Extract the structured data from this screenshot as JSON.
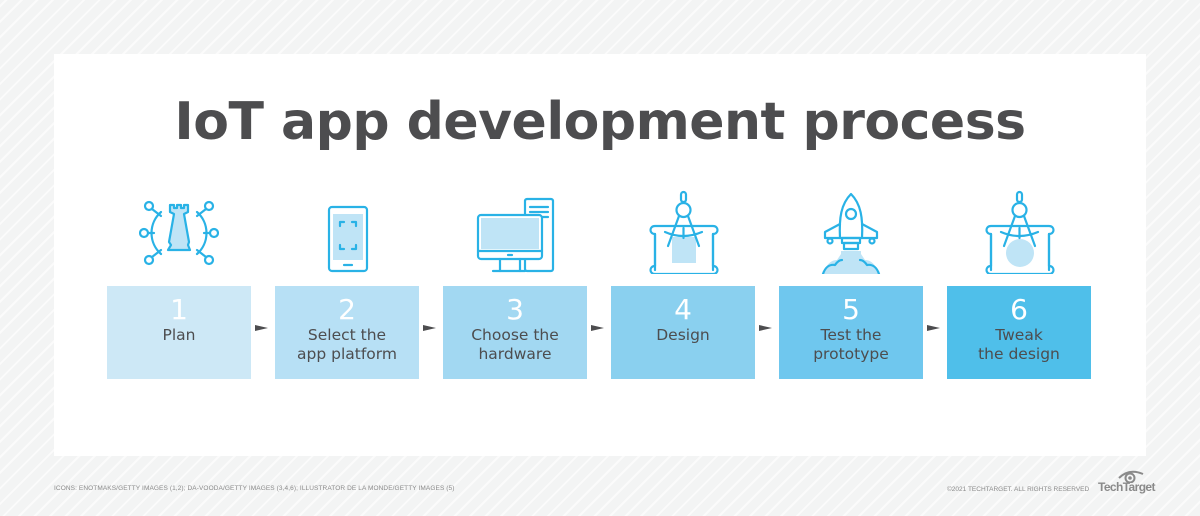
{
  "title": "IoT app development process",
  "steps": [
    {
      "number": "1",
      "label": "Plan",
      "icon": "chess-rook-network-icon",
      "color": "#cde8f6"
    },
    {
      "number": "2",
      "label": "Select the\napp platform",
      "icon": "tablet-icon",
      "color": "#b7e0f5"
    },
    {
      "number": "3",
      "label": "Choose the\nhardware",
      "icon": "desktop-computer-icon",
      "color": "#a2d8f2"
    },
    {
      "number": "4",
      "label": "Design",
      "icon": "compass-blueprint-square-icon",
      "color": "#8ad0ef"
    },
    {
      "number": "5",
      "label": "Test the\nprototype",
      "icon": "rocket-launch-icon",
      "color": "#6fc7ee"
    },
    {
      "number": "6",
      "label": "Tweak\nthe design",
      "icon": "compass-blueprint-circle-icon",
      "color": "#4fbfea"
    }
  ],
  "colors": {
    "icon_stroke": "#29b2e6",
    "icon_fill": "#bfe4f6",
    "text_dark": "#4d4d4f"
  },
  "footer": {
    "credits": "ICONS: ENOTMAKS/GETTY IMAGES (1,2); DA-VOODA/GETTY IMAGES (3,4,6); ILLUSTRATOR DE LA MONDE/GETTY IMAGES (5)",
    "copyright": "©2021 TECHTARGET. ALL RIGHTS RESERVED",
    "brand": "TechTarget"
  }
}
